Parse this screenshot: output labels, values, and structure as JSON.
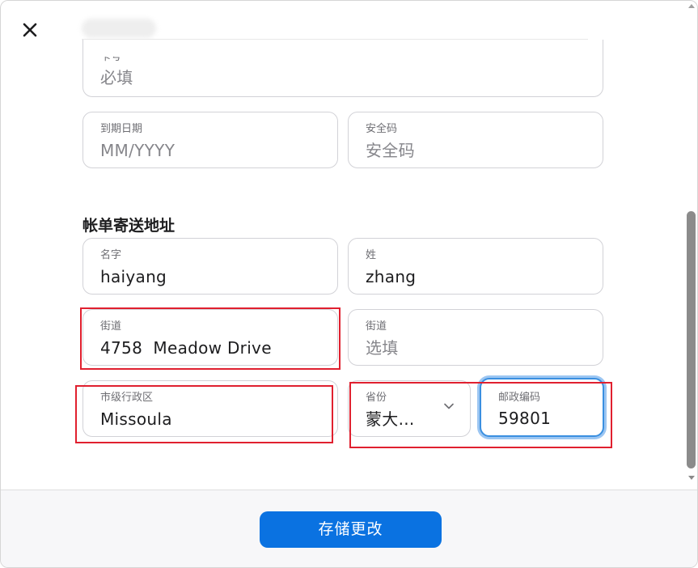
{
  "card": {
    "number": {
      "label": "卡号",
      "placeholder": "必填"
    },
    "expiry": {
      "label": "到期日期",
      "placeholder": "MM/YYYY"
    },
    "security_code": {
      "label": "安全码",
      "placeholder": "安全码"
    }
  },
  "billing": {
    "title": "帐单寄送地址",
    "first_name": {
      "label": "名字",
      "value": "haiyang"
    },
    "last_name": {
      "label": "姓",
      "value": "zhang"
    },
    "street1": {
      "label": "街道",
      "value": "4758  Meadow Drive"
    },
    "street2": {
      "label": "街道",
      "placeholder": "选填"
    },
    "city": {
      "label": "市级行政区",
      "value": "Missoula"
    },
    "province": {
      "label": "省份",
      "value": "蒙大..."
    },
    "zip": {
      "label": "邮政编码",
      "value": "59801"
    }
  },
  "footer": {
    "save_label": "存储更改"
  },
  "icons": {
    "close": "close-icon",
    "chevron": "chevron-down-icon"
  },
  "colors": {
    "accent": "#0a72e1",
    "focus_ring": "#3a8fe0",
    "highlight": "#e0202f"
  }
}
